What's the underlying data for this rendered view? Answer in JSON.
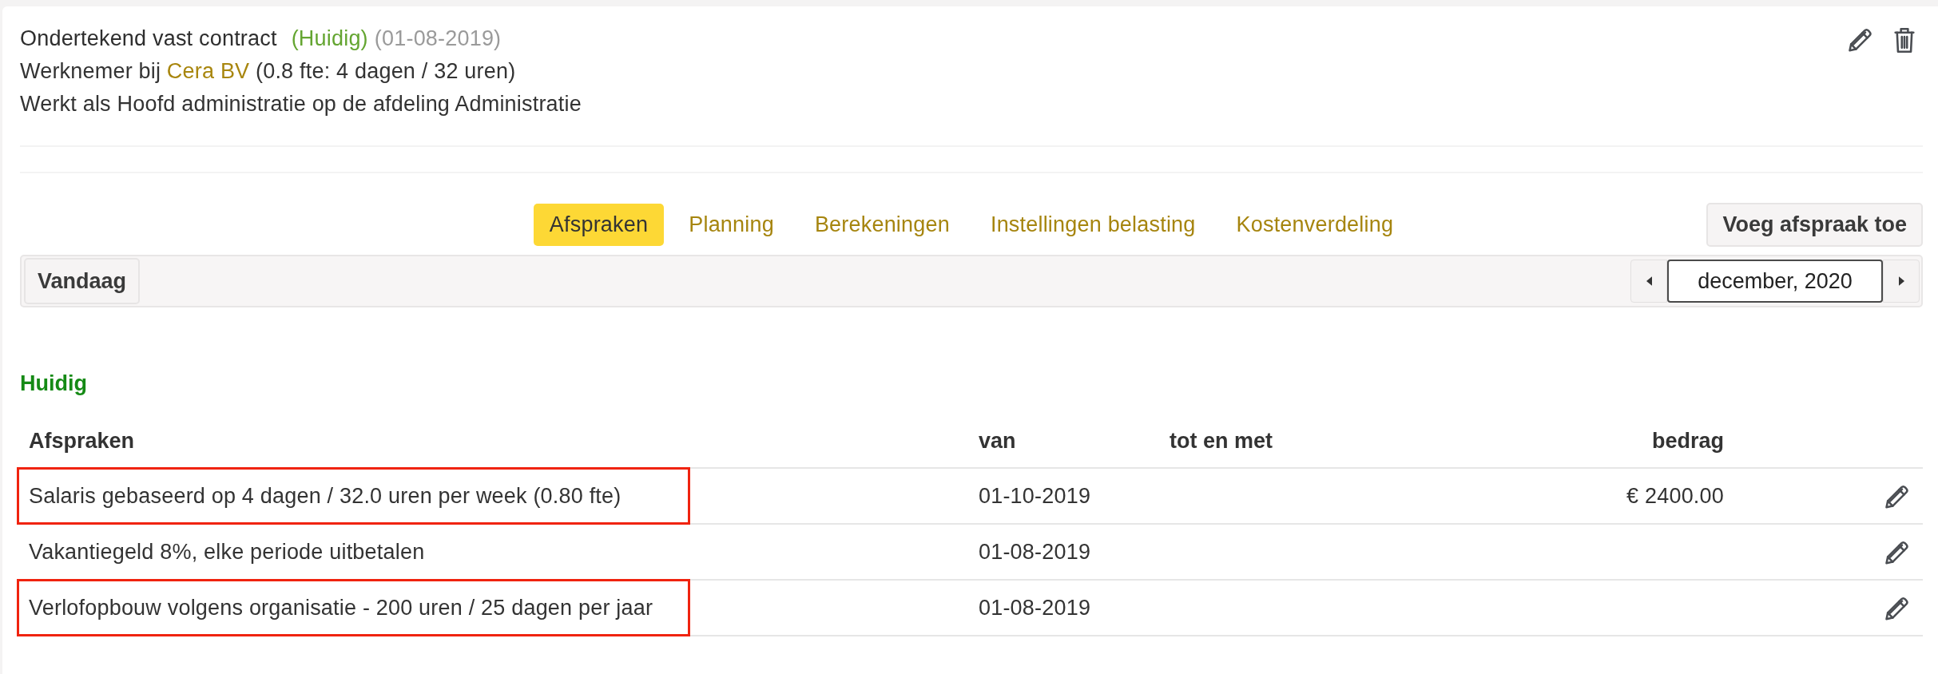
{
  "contract": {
    "title": "Ondertekend vast contract",
    "status": "(Huidig)",
    "start_date": "(01-08-2019)",
    "employment": {
      "prefix": "Werknemer bij",
      "employer": "Cera BV",
      "details": "(0.8 fte: 4 dagen / 32 uren)"
    },
    "role": "Werkt als Hoofd administratie op de afdeling Administratie"
  },
  "tabs": [
    {
      "label": "Afspraken",
      "selected": true
    },
    {
      "label": "Planning",
      "selected": false
    },
    {
      "label": "Berekeningen",
      "selected": false
    },
    {
      "label": "Instellingen belasting",
      "selected": false
    },
    {
      "label": "Kostenverdeling",
      "selected": false
    }
  ],
  "add_button": {
    "label": "Voeg afspraak toe"
  },
  "toolbar": {
    "today_button": {
      "label": "Vandaag"
    },
    "month_field": {
      "value": "december, 2020"
    }
  },
  "section": {
    "title": "Huidig",
    "table": {
      "columns": [
        "Afspraken",
        "van",
        "tot en met",
        "bedrag"
      ],
      "rows": [
        {
          "description": "Salaris gebaseerd op 4 dagen / 32.0 uren per week (0.80 fte)",
          "from": "01-10-2019",
          "amount": "€ 2400.00",
          "highlighted": true
        },
        {
          "description": "Vakantiegeld 8%, elke periode uitbetalen",
          "from": "01-08-2019",
          "highlighted": false
        },
        {
          "description": "Verlofopbouw volgens organisatie - 200 uren / 25 dagen per jaar",
          "from": "01-08-2019",
          "highlighted": true
        }
      ]
    }
  }
}
